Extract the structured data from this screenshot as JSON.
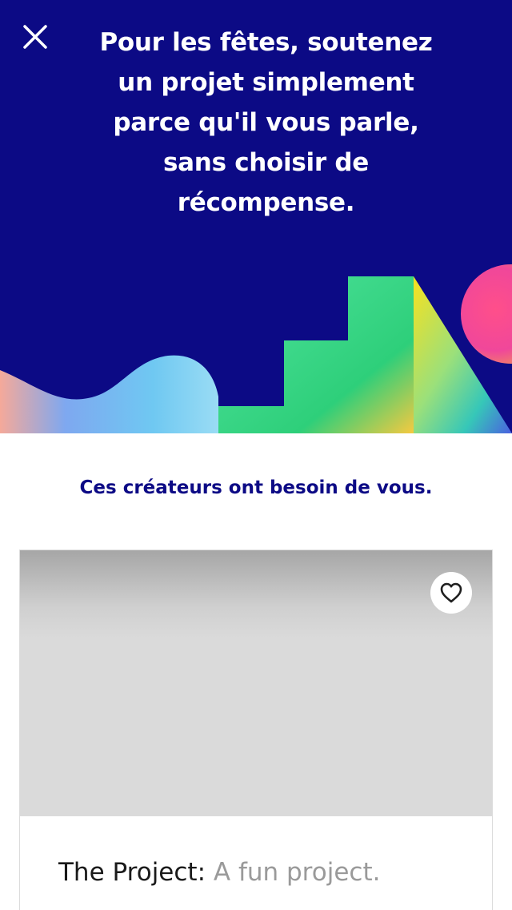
{
  "header": {
    "close_icon": "close-icon",
    "title": "Pour les fêtes, soutenez un projet simplement parce qu'il vous parle, sans choisir de récompense."
  },
  "colors": {
    "brand_navy": "#0c0a85",
    "text_dark": "#1a1a1a",
    "text_muted": "#9a9a9a",
    "card_placeholder": "#dadada"
  },
  "section": {
    "heading": "Ces créateurs ont besoin de vous."
  },
  "project_card": {
    "favorite_icon": "heart-outline-icon",
    "name": "The Project:",
    "blurb": " A fun project."
  }
}
